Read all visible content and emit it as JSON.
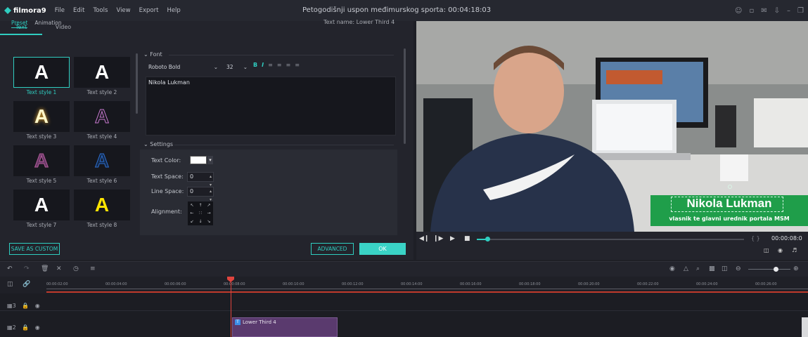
{
  "app": {
    "logo": "filmora9",
    "menu": [
      "File",
      "Edit",
      "Tools",
      "View",
      "Export",
      "Help"
    ],
    "title": "Petogodišnji uspon međimurskog sporta: 00:04:18:03"
  },
  "editor": {
    "tabs": [
      "Text",
      "Video"
    ],
    "subtabs": [
      "Preset",
      "Animation"
    ],
    "text_name": "Text name: Lower Third 4",
    "styles": [
      {
        "label": "Text style 1",
        "glyph": "A",
        "color": "#ffffff"
      },
      {
        "label": "Text style 2",
        "glyph": "A",
        "color": "#ffffff"
      },
      {
        "label": "Text style 3",
        "glyph": "A",
        "color": "#fff7c8"
      },
      {
        "label": "Text style 4",
        "glyph": "A",
        "color": "#c879d0"
      },
      {
        "label": "Text style 5",
        "glyph": "A",
        "color": "#b45b9b"
      },
      {
        "label": "Text style 6",
        "glyph": "A",
        "color": "#2f6fd0"
      },
      {
        "label": "Text style 7",
        "glyph": "A",
        "color": "#ffffff"
      },
      {
        "label": "Text style 8",
        "glyph": "A",
        "color": "#ffe500"
      }
    ],
    "font_section": "Font",
    "font_name": "Roboto Bold",
    "font_size": "32",
    "text_value": "Nikola Lukman",
    "settings_section": "Settings",
    "text_color_label": "Text Color:",
    "text_color": "#ffffff",
    "text_space_label": "Text Space:",
    "text_space": "0",
    "line_space_label": "Line Space:",
    "line_space": "0",
    "alignment_label": "Alignment:",
    "save_custom": "SAVE AS CUSTOM",
    "advanced": "ADVANCED",
    "ok": "OK"
  },
  "preview": {
    "lower_third_name": "Nikola Lukman",
    "lower_third_sub": "vlasnik te glavni urednik portala MSM",
    "timecode": "00:00:08:0",
    "brace": "{ }"
  },
  "timeline": {
    "ticks": [
      "00:00:02:00",
      "00:00:04:00",
      "00:00:06:00",
      "00:00:08:00",
      "00:00:10:00",
      "00:00:12:00",
      "00:00:14:00",
      "00:00:16:00",
      "00:00:18:00",
      "00:00:20:00",
      "00:00:22:00",
      "00:00:24:00",
      "00:00:26:00"
    ],
    "clip_label": "Lower Third 4",
    "tracks": [
      "3",
      "2"
    ]
  },
  "colors": {
    "accent": "#2fcdc0",
    "playhead": "#e0443e",
    "lower_third_green": "#1f9e4a"
  }
}
